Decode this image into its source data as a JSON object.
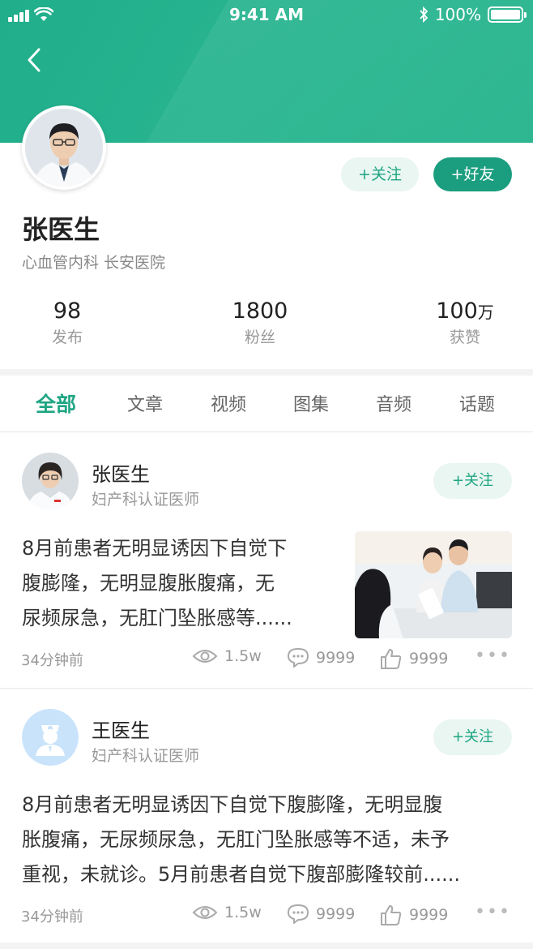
{
  "status_bar": {
    "time": "9:41 AM",
    "battery": "100%"
  },
  "profile": {
    "name": "张医生",
    "department": "心血管内科 长安医院",
    "follow_label": "+关注",
    "friend_label": "+好友",
    "stats": [
      {
        "value": "98",
        "unit": "",
        "label": "发布"
      },
      {
        "value": "1800",
        "unit": "",
        "label": "粉丝"
      },
      {
        "value": "100",
        "unit": "万",
        "label": "获赞"
      }
    ]
  },
  "tabs": [
    "全部",
    "文章",
    "视频",
    "图集",
    "音频",
    "话题"
  ],
  "active_tab": "全部",
  "posts": [
    {
      "author": "张医生",
      "role": "妇产科认证医师",
      "follow_label": "+关注",
      "text_lines": [
        "8月前患者无明显诱因下自觉下",
        "腹膨隆，无明显腹胀腹痛，无",
        "尿频尿急，无肛门坠胀感等......"
      ],
      "time": "34分钟前",
      "views": "1.5w",
      "comments": "9999",
      "likes": "9999",
      "has_image": true
    },
    {
      "author": "王医生",
      "role": "妇产科认证医师",
      "follow_label": "+关注",
      "text_lines": [
        "8月前患者无明显诱因下自觉下腹膨隆，无明显腹",
        "胀腹痛，无尿频尿急，无肛门坠胀感等不适，未予",
        "重视，未就诊。5月前患者自觉下腹部膨隆较前......"
      ],
      "time": "34分钟前",
      "views": "1.5w",
      "comments": "9999",
      "likes": "9999",
      "has_image": false
    }
  ],
  "colors": {
    "brand": "#1fa583",
    "brand_dark": "#1b9e7f",
    "header_green": "#24b08c"
  },
  "icons": [
    "back-icon",
    "signal-icon",
    "wifi-icon",
    "bluetooth-icon",
    "battery-icon",
    "eye-icon",
    "comment-icon",
    "thumbs-up-icon",
    "more-icon"
  ]
}
